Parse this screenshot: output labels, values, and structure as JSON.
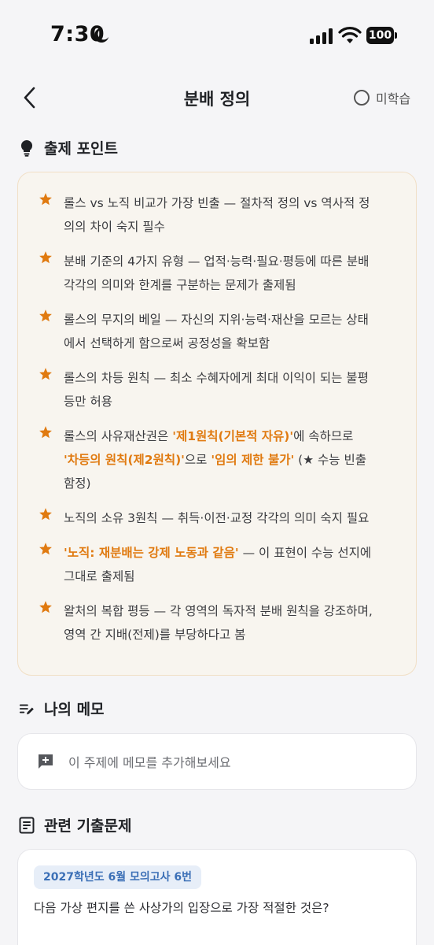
{
  "status_bar": {
    "time": "7:30",
    "battery": "100"
  },
  "header": {
    "title": "분배 정의",
    "status_label": "미학습"
  },
  "points_section": {
    "heading": "출제 포인트",
    "items": [
      {
        "lines": [
          [
            {
              "t": "롤스 vs 노직 비교가 가장 빈출 — 절차적 정의 vs 역사적 정"
            }
          ],
          [
            {
              "t": "의의 차이 숙지 필수"
            }
          ]
        ]
      },
      {
        "lines": [
          [
            {
              "t": "분배 기준의 4가지 유형 — 업적·능력·필요·평등에 따른 분배"
            }
          ],
          [
            {
              "t": "각각의 의미와  한계를 구분하는 문제가 출제됨"
            }
          ]
        ]
      },
      {
        "lines": [
          [
            {
              "t": "롤스의 무지의 베일 — 자신의 지위·능력·재산을 모르는 상태"
            }
          ],
          [
            {
              "t": "에서  선택하게 함으로써 공정성을 확보함"
            }
          ]
        ]
      },
      {
        "lines": [
          [
            {
              "t": "롤스의 차등 원칙 — 최소 수혜자에게 최대 이익이 되는 불평"
            }
          ],
          [
            {
              "t": "등만 허용"
            }
          ]
        ]
      },
      {
        "lines": [
          [
            {
              "t": "롤스의 사유재산권은 "
            },
            {
              "t": "'제1원칙(기본적 자유)'",
              "h": true
            },
            {
              "t": "에 속하므로"
            }
          ],
          [
            {
              "t": "'차등의 원칙(제2원칙)'",
              "h": true
            },
            {
              "t": "으로 "
            },
            {
              "t": "'임의 제한 불가'",
              "h": true
            },
            {
              "t": " (★ 수능 빈출"
            }
          ],
          [
            {
              "t": "함정)"
            }
          ]
        ]
      },
      {
        "lines": [
          [
            {
              "t": "노직의 소유 3원칙 — 취득·이전·교정 각각의 의미 숙지 필요"
            }
          ]
        ]
      },
      {
        "lines": [
          [
            {
              "t": "'노직: 재분배는 강제 노동과 같음'",
              "h": true
            },
            {
              "t": " — 이 표현이 수능 선지에"
            }
          ],
          [
            {
              "t": "그대로 출제됨"
            }
          ]
        ]
      },
      {
        "lines": [
          [
            {
              "t": "왈처의 복합 평등 — 각 영역의 독자적 분배 원칙을 강조하며,"
            }
          ],
          [
            {
              "t": "영역 간 지배(전제)를 부당하다고 봄"
            }
          ]
        ]
      }
    ]
  },
  "memo_section": {
    "heading": "나의 메모",
    "placeholder": "이 주제에 메모를 추가해보세요"
  },
  "questions_section": {
    "heading": "관련 기출문제",
    "items": [
      {
        "badge": "2027학년도 6월 모의고사 6번",
        "question": "다음 가상 편지를 쓴 사상가의 입장으로 가장 적절한 것은?"
      }
    ]
  },
  "colors": {
    "accent": "#e07a10",
    "card_bg": "#f8f5ef",
    "badge_text": "#3b6fb6"
  }
}
